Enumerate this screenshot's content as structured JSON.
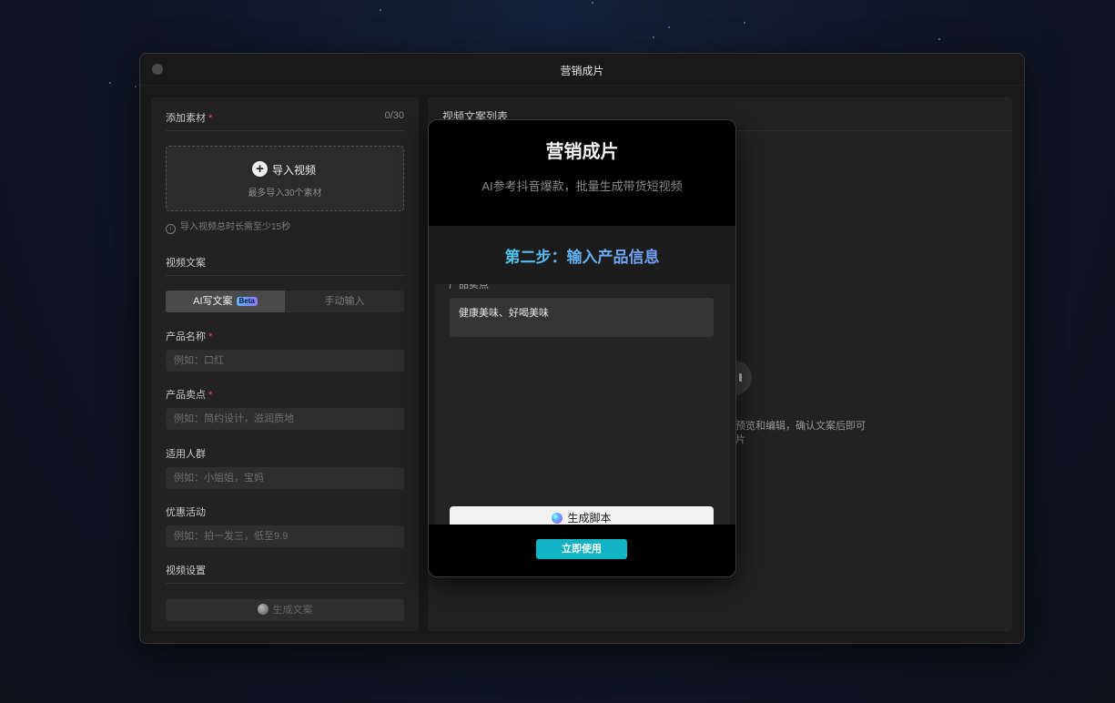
{
  "window": {
    "title": "营销成片"
  },
  "left": {
    "add_material_label": "添加素材",
    "material_count": "0/30",
    "upload": {
      "title": "导入视频",
      "subtitle": "最多导入30个素材"
    },
    "hint": "导入视频总时长需至少15秒",
    "copy_section_label": "视频文案",
    "tabs": [
      {
        "label": "AI写文案",
        "badge": "Beta"
      },
      {
        "label": "手动输入"
      }
    ],
    "fields": {
      "product_name": {
        "label": "产品名称",
        "placeholder": "例如：口红"
      },
      "selling_point": {
        "label": "产品卖点",
        "placeholder": "例如：简约设计，滋润质地"
      },
      "audience": {
        "label": "适用人群",
        "placeholder": "例如：小姐姐，宝妈"
      },
      "promotion": {
        "label": "优惠活动",
        "placeholder": "例如：拍一发三，低至9.9"
      }
    },
    "video_settings_label": "视频设置",
    "generate_button": "生成文案"
  },
  "right": {
    "title": "视频文案列表",
    "desc_line1": "预览和编辑，确认文案后即可",
    "desc_line2": "片"
  },
  "modal": {
    "title": "营销成片",
    "subtitle": "AI参考抖音爆款，批量生成带货短视频",
    "step": "第二步：输入产品信息",
    "cut_label": "产品卖点",
    "selling_point_value": "健康美味、好喝美味",
    "generate_script_button": "生成脚本",
    "use_now_button": "立即使用"
  },
  "colors": {
    "accent": "#11b4c4",
    "required": "#ff4d4f",
    "step_gradient_start": "#3ed6e6",
    "step_gradient_end": "#8a8cff"
  }
}
